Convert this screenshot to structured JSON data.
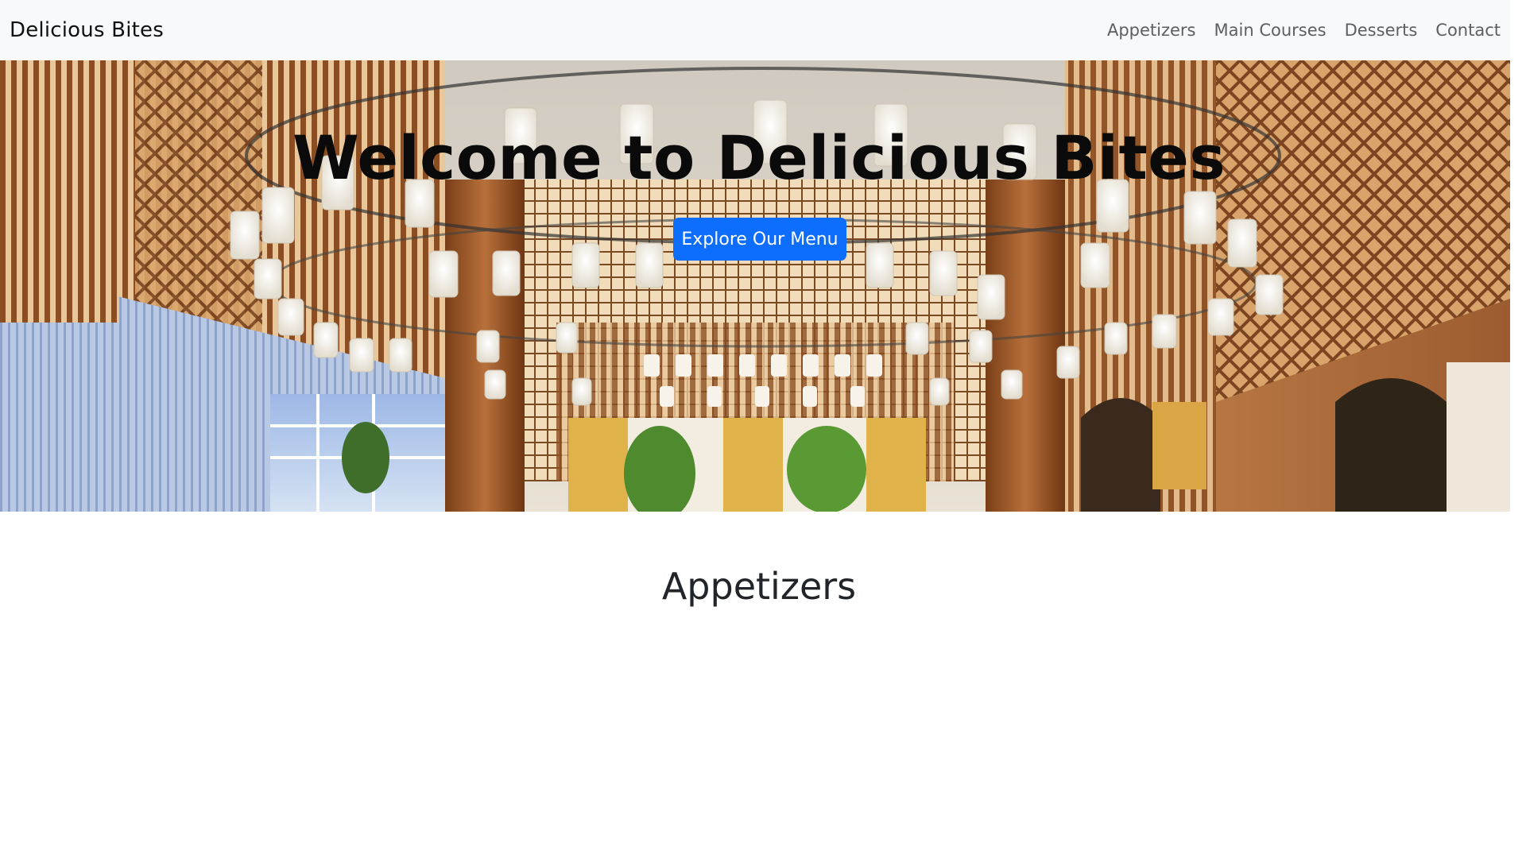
{
  "navbar": {
    "brand": "Delicious Bites",
    "links": [
      {
        "label": "Appetizers"
      },
      {
        "label": "Main Courses"
      },
      {
        "label": "Desserts"
      },
      {
        "label": "Contact"
      }
    ]
  },
  "hero": {
    "title": "Welcome to Delicious Bites",
    "button_label": "Explore Our Menu",
    "image_subject": "restaurant interior with wooden lattice walls and hanging paper lanterns"
  },
  "sections": [
    {
      "title": "Appetizers"
    }
  ],
  "colors": {
    "navbar_bg": "#f8f9fa",
    "button_primary": "#0d6efd",
    "nav_link": "#5b5f63",
    "heading": "#212529"
  }
}
